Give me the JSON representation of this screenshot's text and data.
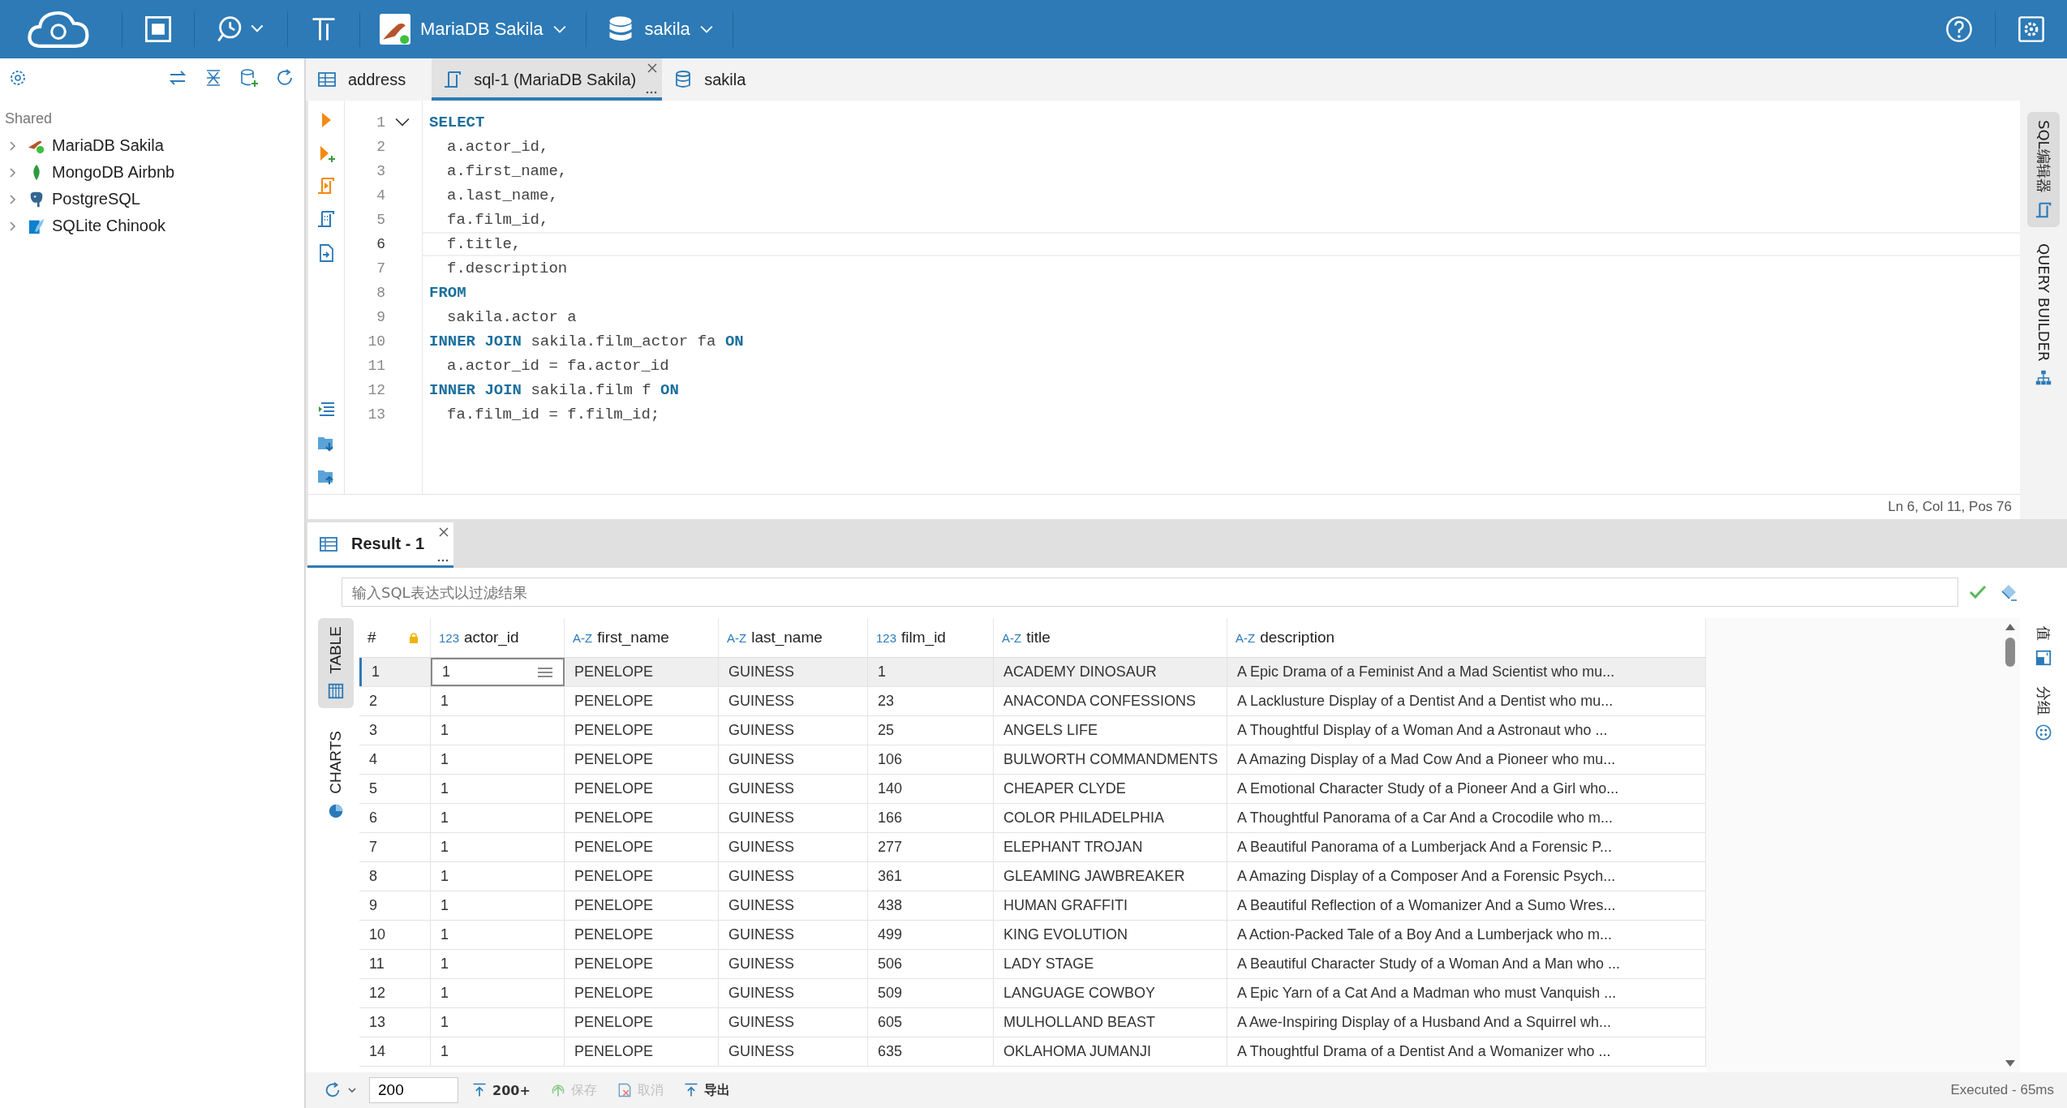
{
  "toolbar": {
    "connection": "MariaDB Sakila",
    "database": "sakila"
  },
  "sidebar": {
    "section": "Shared",
    "connections": [
      {
        "name": "MariaDB Sakila",
        "kind": "mariadb",
        "expanded": false
      },
      {
        "name": "MongoDB Airbnb",
        "kind": "mongodb",
        "expanded": false
      },
      {
        "name": "PostgreSQL",
        "kind": "postgresql",
        "expanded": false
      },
      {
        "name": "SQLite Chinook",
        "kind": "sqlite",
        "expanded": false
      }
    ]
  },
  "tabs": [
    {
      "label": "address",
      "kind": "table",
      "selected": false
    },
    {
      "label": "sql-1 (MariaDB Sakila)",
      "kind": "sql",
      "selected": true
    },
    {
      "label": "sakila",
      "kind": "database",
      "selected": false
    }
  ],
  "editor": {
    "lines": [
      {
        "number": "1",
        "current": false,
        "indented": false,
        "fold_expanded": true,
        "tokens": [
          {
            "text": "SELECT",
            "kind": "keyword"
          }
        ]
      },
      {
        "number": "2",
        "current": false,
        "indented": true,
        "tokens": [
          {
            "text": "a.actor_id,",
            "kind": "plain"
          }
        ]
      },
      {
        "number": "3",
        "current": false,
        "indented": true,
        "tokens": [
          {
            "text": "a.first_name,",
            "kind": "plain"
          }
        ]
      },
      {
        "number": "4",
        "current": false,
        "indented": true,
        "tokens": [
          {
            "text": "a.last_name,",
            "kind": "plain"
          }
        ]
      },
      {
        "number": "5",
        "current": false,
        "indented": true,
        "tokens": [
          {
            "text": "fa.film_id,",
            "kind": "plain"
          }
        ]
      },
      {
        "number": "6",
        "current": true,
        "indented": true,
        "tokens": [
          {
            "text": "f.title,",
            "kind": "plain"
          }
        ]
      },
      {
        "number": "7",
        "current": false,
        "indented": true,
        "tokens": [
          {
            "text": "f.description",
            "kind": "plain"
          }
        ]
      },
      {
        "number": "8",
        "current": false,
        "indented": false,
        "tokens": [
          {
            "text": "FROM",
            "kind": "keyword"
          }
        ]
      },
      {
        "number": "9",
        "current": false,
        "indented": true,
        "tokens": [
          {
            "text": "sakila.actor a",
            "kind": "plain"
          }
        ]
      },
      {
        "number": "10",
        "current": false,
        "indented": false,
        "tokens": [
          {
            "text": "INNER JOIN",
            "kind": "keyword"
          },
          {
            "text": " sakila.film_actor fa ",
            "kind": "plain"
          },
          {
            "text": "ON",
            "kind": "keyword"
          }
        ]
      },
      {
        "number": "11",
        "current": false,
        "indented": true,
        "tokens": [
          {
            "text": "a.actor_id = fa.actor_id",
            "kind": "plain"
          }
        ]
      },
      {
        "number": "12",
        "current": false,
        "indented": false,
        "tokens": [
          {
            "text": "INNER JOIN",
            "kind": "keyword"
          },
          {
            "text": " sakila.film f ",
            "kind": "plain"
          },
          {
            "text": "ON",
            "kind": "keyword"
          }
        ]
      },
      {
        "number": "13",
        "current": false,
        "indented": true,
        "tokens": [
          {
            "text": "fa.film_id = f.film_id;",
            "kind": "plain"
          }
        ]
      }
    ],
    "status": "Ln 6, Col 11, Pos 76"
  },
  "side_tabs": [
    {
      "label": "SQL编辑器",
      "kind": "sql",
      "selected": true
    },
    {
      "label": "QUERY BUILDER",
      "kind": "builder",
      "selected": false
    }
  ],
  "result": {
    "tab": "Result - 1",
    "filter_placeholder": "输入SQL表达式以过滤结果",
    "views": [
      {
        "label": "TABLE",
        "kind": "table",
        "selected": true
      },
      {
        "label": "CHARTS",
        "kind": "charts",
        "selected": false
      }
    ],
    "panels": [
      {
        "label": "值",
        "kind": "value"
      },
      {
        "label": "分组",
        "kind": "group"
      }
    ],
    "index_header": "#",
    "columns": [
      {
        "name": "actor_id",
        "type": "123",
        "focused": true
      },
      {
        "name": "first_name",
        "type": "A-Z",
        "focused": false
      },
      {
        "name": "last_name",
        "type": "A-Z",
        "focused": false
      },
      {
        "name": "film_id",
        "type": "123",
        "focused": false
      },
      {
        "name": "title",
        "type": "A-Z",
        "focused": false
      },
      {
        "name": "description",
        "type": "A-Z",
        "focused": false
      }
    ],
    "rows": [
      {
        "number": "1",
        "selected": true,
        "cells": [
          "1",
          "PENELOPE",
          "GUINESS",
          "1",
          "ACADEMY DINOSAUR",
          "A Epic Drama of a Feminist And a Mad Scientist who mu..."
        ]
      },
      {
        "number": "2",
        "selected": false,
        "cells": [
          "1",
          "PENELOPE",
          "GUINESS",
          "23",
          "ANACONDA CONFESSIONS",
          "A Lacklusture Display of a Dentist And a Dentist who mu..."
        ]
      },
      {
        "number": "3",
        "selected": false,
        "cells": [
          "1",
          "PENELOPE",
          "GUINESS",
          "25",
          "ANGELS LIFE",
          "A Thoughtful Display of a Woman And a Astronaut who ..."
        ]
      },
      {
        "number": "4",
        "selected": false,
        "cells": [
          "1",
          "PENELOPE",
          "GUINESS",
          "106",
          "BULWORTH COMMANDMENTS",
          "A Amazing Display of a Mad Cow And a Pioneer who mu..."
        ]
      },
      {
        "number": "5",
        "selected": false,
        "cells": [
          "1",
          "PENELOPE",
          "GUINESS",
          "140",
          "CHEAPER CLYDE",
          "A Emotional Character Study of a Pioneer And a Girl who..."
        ]
      },
      {
        "number": "6",
        "selected": false,
        "cells": [
          "1",
          "PENELOPE",
          "GUINESS",
          "166",
          "COLOR PHILADELPHIA",
          "A Thoughtful Panorama of a Car And a Crocodile who m..."
        ]
      },
      {
        "number": "7",
        "selected": false,
        "cells": [
          "1",
          "PENELOPE",
          "GUINESS",
          "277",
          "ELEPHANT TROJAN",
          "A Beautiful Panorama of a Lumberjack And a Forensic P..."
        ]
      },
      {
        "number": "8",
        "selected": false,
        "cells": [
          "1",
          "PENELOPE",
          "GUINESS",
          "361",
          "GLEAMING JAWBREAKER",
          "A Amazing Display of a Composer And a Forensic Psych..."
        ]
      },
      {
        "number": "9",
        "selected": false,
        "cells": [
          "1",
          "PENELOPE",
          "GUINESS",
          "438",
          "HUMAN GRAFFITI",
          "A Beautiful Reflection of a Womanizer And a Sumo Wres..."
        ]
      },
      {
        "number": "10",
        "selected": false,
        "cells": [
          "1",
          "PENELOPE",
          "GUINESS",
          "499",
          "KING EVOLUTION",
          "A Action-Packed Tale of a Boy And a Lumberjack who m..."
        ]
      },
      {
        "number": "11",
        "selected": false,
        "cells": [
          "1",
          "PENELOPE",
          "GUINESS",
          "506",
          "LADY STAGE",
          "A Beautiful Character Study of a Woman And a Man who ..."
        ]
      },
      {
        "number": "12",
        "selected": false,
        "cells": [
          "1",
          "PENELOPE",
          "GUINESS",
          "509",
          "LANGUAGE COWBOY",
          "A Epic Yarn of a Cat And a Madman who must Vanquish ..."
        ]
      },
      {
        "number": "13",
        "selected": false,
        "cells": [
          "1",
          "PENELOPE",
          "GUINESS",
          "605",
          "MULHOLLAND BEAST",
          "A Awe-Inspiring Display of a Husband And a Squirrel wh..."
        ]
      },
      {
        "number": "14",
        "selected": false,
        "cells": [
          "1",
          "PENELOPE",
          "GUINESS",
          "635",
          "OKLAHOMA JUMANJI",
          "A Thoughtful Drama of a Dentist And a Womanizer who ..."
        ]
      }
    ]
  },
  "footer": {
    "limit": "200",
    "fetch_more": "200+",
    "actions": [
      {
        "label": "保存",
        "kind": "save",
        "disabled": true
      },
      {
        "label": "取消",
        "kind": "cancel",
        "disabled": true
      },
      {
        "label": "导出",
        "kind": "export",
        "disabled": false
      }
    ],
    "status": "Executed - 65ms"
  }
}
